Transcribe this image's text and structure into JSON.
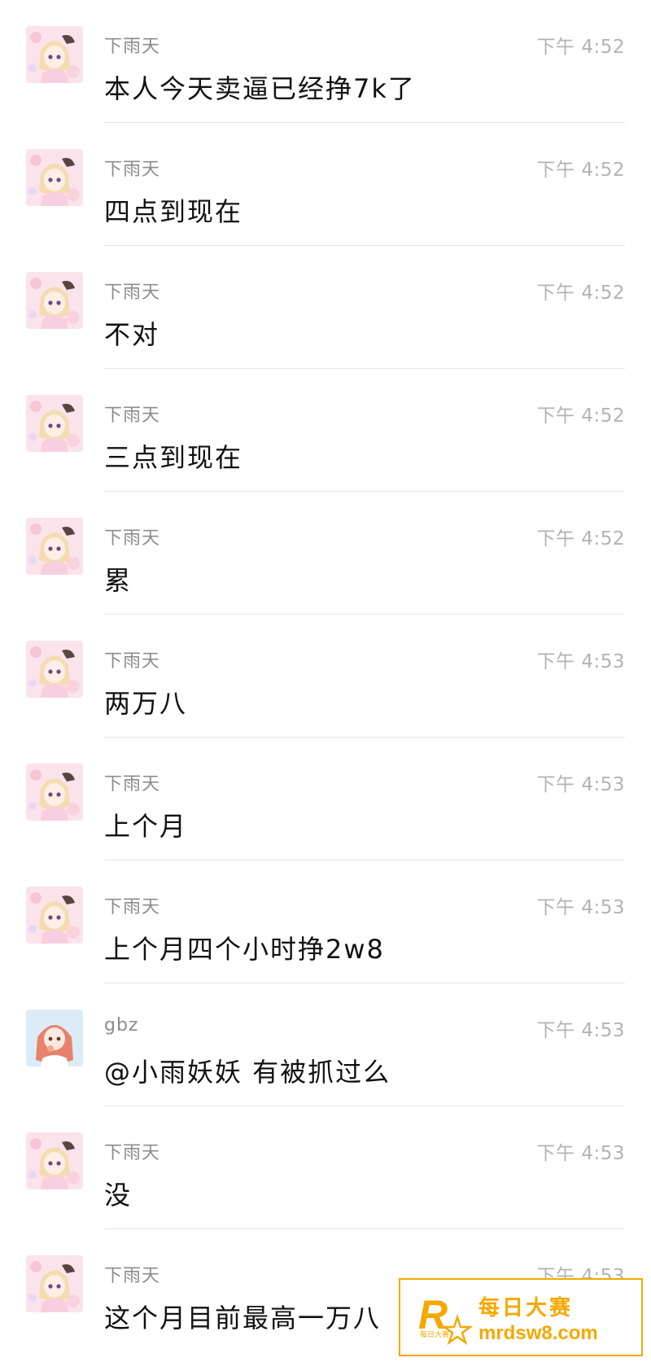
{
  "messages": [
    {
      "sender": "下雨天",
      "time": "下午 4:52",
      "text": "本人今天卖逼已经挣7k了",
      "avatar_icon": "anime-girl-avatar"
    },
    {
      "sender": "下雨天",
      "time": "下午 4:52",
      "text": "四点到现在",
      "avatar_icon": "anime-girl-avatar"
    },
    {
      "sender": "下雨天",
      "time": "下午 4:52",
      "text": "不对",
      "avatar_icon": "anime-girl-avatar"
    },
    {
      "sender": "下雨天",
      "time": "下午 4:52",
      "text": "三点到现在",
      "avatar_icon": "anime-girl-avatar"
    },
    {
      "sender": "下雨天",
      "time": "下午 4:52",
      "text": "累",
      "avatar_icon": "anime-girl-avatar"
    },
    {
      "sender": "下雨天",
      "time": "下午 4:53",
      "text": "两万八",
      "avatar_icon": "anime-girl-avatar"
    },
    {
      "sender": "下雨天",
      "time": "下午 4:53",
      "text": "上个月",
      "avatar_icon": "anime-girl-avatar"
    },
    {
      "sender": "下雨天",
      "time": "下午 4:53",
      "text": "上个月四个小时挣2w8",
      "avatar_icon": "anime-girl-avatar"
    },
    {
      "sender": "gbz",
      "time": "下午 4:53",
      "text": "@小雨妖妖 有被抓过么",
      "avatar_icon": "red-hair-girl-avatar"
    },
    {
      "sender": "下雨天",
      "time": "下午 4:53",
      "text": "没",
      "avatar_icon": "anime-girl-avatar"
    },
    {
      "sender": "下雨天",
      "time": "下午 4:53",
      "text": "这个月目前最高一万八",
      "avatar_icon": "anime-girl-avatar"
    }
  ],
  "watermark": {
    "title": "每日大赛",
    "url": "mrdsw8.com",
    "logo_letter": "R",
    "logo_small_text": "每日大赛",
    "color": "#f5a800"
  },
  "colors": {
    "sender": "#8c8c8c",
    "time": "#b3b3b3",
    "text": "#111111",
    "divider": "#e6e6e6"
  }
}
